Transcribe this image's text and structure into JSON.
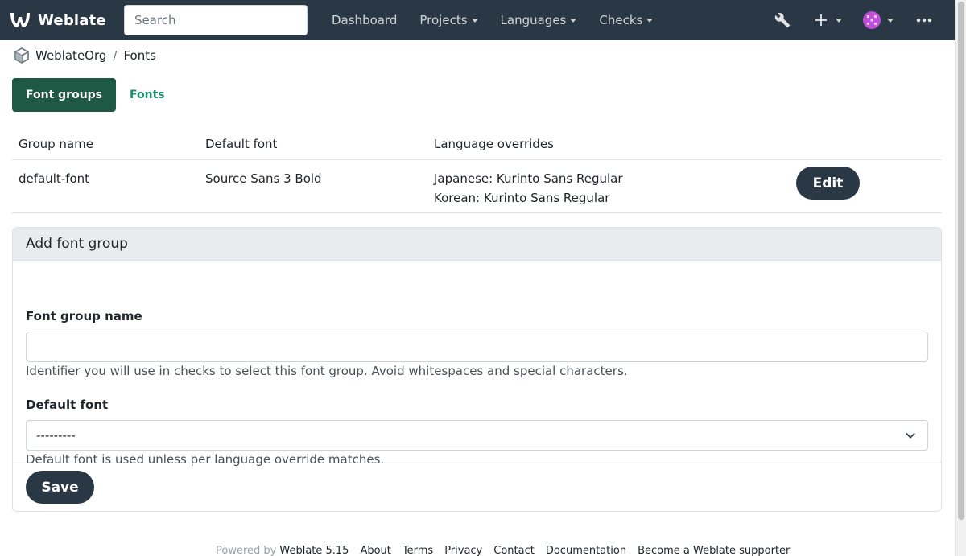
{
  "navbar": {
    "brand": "Weblate",
    "search_placeholder": "Search",
    "links": [
      "Dashboard",
      "Projects",
      "Languages",
      "Checks"
    ],
    "colors": {
      "background": "#2a3744"
    }
  },
  "breadcrumb": {
    "org": "WeblateOrg",
    "separator": "/",
    "page": "Fonts"
  },
  "tabs": {
    "font_groups": "Font groups",
    "fonts": "Fonts"
  },
  "table": {
    "headers": {
      "group_name": "Group name",
      "default_font": "Default font",
      "language_overrides": "Language overrides"
    },
    "rows": [
      {
        "group_name": "default-font",
        "default_font": "Source Sans 3 Bold",
        "overrides": [
          "Japanese: Kurinto Sans Regular",
          "Korean: Kurinto Sans Regular"
        ],
        "action": "Edit"
      }
    ]
  },
  "form": {
    "title": "Add font group",
    "group_name_label": "Font group name",
    "group_name_value": "",
    "group_name_help": "Identifier you will use in checks to select this font group. Avoid whitespaces and special characters.",
    "default_font_label": "Default font",
    "default_font_selected": "---------",
    "default_font_help": "Default font is used unless per language override matches.",
    "save": "Save"
  },
  "footer": {
    "powered_by": "Powered by",
    "version": "Weblate 5.15",
    "links": [
      "About",
      "Terms",
      "Privacy",
      "Contact",
      "Documentation",
      "Become a Weblate supporter"
    ]
  }
}
